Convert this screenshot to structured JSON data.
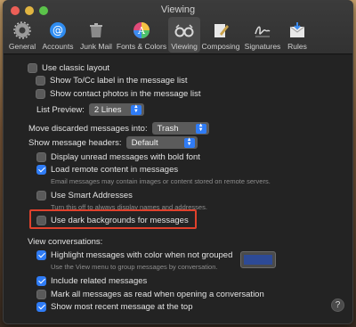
{
  "window": {
    "title": "Viewing"
  },
  "toolbar": [
    {
      "label": "General",
      "icon": "general-icon"
    },
    {
      "label": "Accounts",
      "icon": "accounts-icon"
    },
    {
      "label": "Junk Mail",
      "icon": "junk-mail-icon"
    },
    {
      "label": "Fonts & Colors",
      "icon": "fonts-colors-icon"
    },
    {
      "label": "Viewing",
      "icon": "viewing-icon",
      "selected": true
    },
    {
      "label": "Composing",
      "icon": "composing-icon"
    },
    {
      "label": "Signatures",
      "icon": "signatures-icon"
    },
    {
      "label": "Rules",
      "icon": "rules-icon"
    }
  ],
  "layout": {
    "classic": {
      "label": "Use classic layout",
      "checked": false
    },
    "show_tocc": {
      "label": "Show To/Cc label in the message list",
      "checked": false
    },
    "show_photos": {
      "label": "Show contact photos in the message list",
      "checked": false
    },
    "list_preview_label": "List Preview:",
    "list_preview_value": "2 Lines"
  },
  "discarded": {
    "label": "Move discarded messages into:",
    "value": "Trash"
  },
  "headers": {
    "label": "Show message headers:",
    "value": "Default"
  },
  "options": {
    "bold_unread": {
      "label": "Display unread messages with bold font",
      "checked": false
    },
    "remote_content": {
      "label": "Load remote content in messages",
      "checked": true
    },
    "remote_hint": "Email messages may contain images or content stored on remote servers.",
    "smart_addresses": {
      "label": "Use Smart Addresses",
      "checked": false
    },
    "smart_hint": "Turn this off to always display names and addresses.",
    "dark_backgrounds": {
      "label": "Use dark backgrounds for messages",
      "checked": false
    }
  },
  "conversations": {
    "heading": "View conversations:",
    "highlight": {
      "label": "Highlight messages with color when not grouped",
      "checked": true
    },
    "highlight_hint": "Use the View menu to group messages by conversation.",
    "highlight_color": "#2d4a96",
    "include_related": {
      "label": "Include related messages",
      "checked": true
    },
    "mark_read": {
      "label": "Mark all messages as read when opening a conversation",
      "checked": false
    },
    "most_recent_top": {
      "label": "Show most recent message at the top",
      "checked": true
    }
  },
  "help": {
    "label": "?"
  }
}
